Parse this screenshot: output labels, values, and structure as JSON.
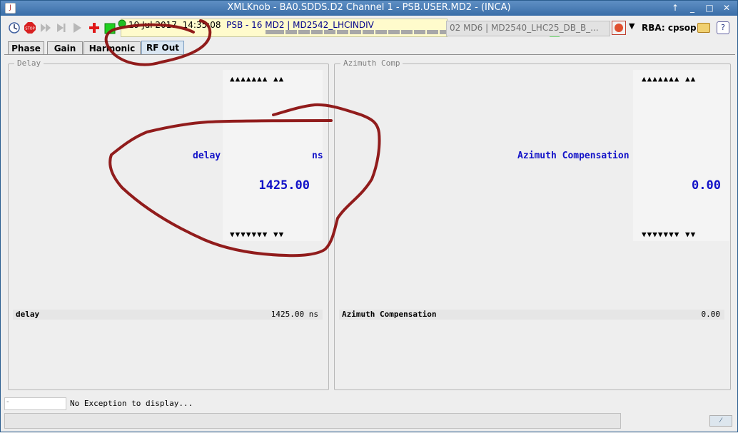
{
  "window": {
    "title": "XMLKnob - BA0.SDDS.D2 Channel 1 - PSB.USER.MD2 - (INCA)",
    "app_icon_text": "J",
    "btn_up": "↑",
    "btn_min": "_",
    "btn_max": "□",
    "btn_close": "✕"
  },
  "toolbar": {
    "icons": [
      "clock-icon",
      "stop-icon",
      "fast-forward-icon",
      "step-forward-icon",
      "play-icon",
      "add-icon",
      "status-led-icon"
    ],
    "date": "19 Jul 2017",
    "time": "14:35:08",
    "cycle": "PSB - 16 MD2 | MD2542_LHCINDIV",
    "segment_count": "22",
    "next_cycle": "02 MD6 | MD2540_LHC25_DB_B_...",
    "rba_label": "RBA: cpsop"
  },
  "tabs": [
    {
      "label": "Phase",
      "active": false
    },
    {
      "label": "Gain",
      "active": false
    },
    {
      "label": "Harmonic",
      "active": false
    },
    {
      "label": "RF Out",
      "active": true
    }
  ],
  "panels": {
    "delay": {
      "legend": "Delay",
      "up_arrows": "▲▲▲▲▲▲▲ ▲▲",
      "down_arrows": "▼▼▼▼▼▼▼ ▼▼",
      "label": "delay",
      "unit": "ns",
      "value": "1425.00",
      "summary_name": "delay",
      "summary_value": "1425.00 ns"
    },
    "azimuth": {
      "legend": "Azimuth Comp",
      "up_arrows": "▲▲▲▲▲▲▲ ▲▲",
      "down_arrows": "▼▼▼▼▼▼▼ ▼▼",
      "label": "Azimuth Compensation",
      "value": "0.00",
      "summary_name": "Azimuth Compensation",
      "summary_value": "0.00"
    }
  },
  "status": {
    "field": "-",
    "message": "No Exception to display...",
    "bottom_button": "⁄"
  },
  "colors": {
    "knob_text": "#1212c8",
    "annotation": "#8b1010",
    "title_bar": "#3a6ea8"
  }
}
